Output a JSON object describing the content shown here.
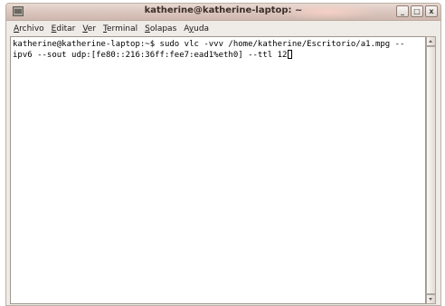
{
  "window": {
    "title": "katherine@katherine-laptop: ~",
    "minimize_glyph": "_",
    "maximize_glyph": "□",
    "close_glyph": "x",
    "icon": "terminal-window-icon"
  },
  "menubar": {
    "items": [
      {
        "mnemonic": "A",
        "rest": "rchivo"
      },
      {
        "mnemonic": "E",
        "rest": "ditar"
      },
      {
        "mnemonic": "V",
        "rest": "er"
      },
      {
        "mnemonic": "T",
        "rest": "erminal"
      },
      {
        "mnemonic": "S",
        "rest": "olapas"
      },
      {
        "prefix": "A",
        "mnemonic": "y",
        "rest": "uda"
      }
    ]
  },
  "terminal": {
    "lines": [
      "katherine@katherine-laptop:~$ sudo vlc -vvv /home/katherine/Escritorio/a1.mpg --",
      "ipv6 --sout udp:[fe80::216:36ff:fee7:ead1%eth0] --ttl 12"
    ]
  },
  "colors": {
    "titlebar": "#dcc8c0",
    "window_bg": "#efebe7",
    "terminal_bg": "#ffffff",
    "terminal_fg": "#000000"
  }
}
